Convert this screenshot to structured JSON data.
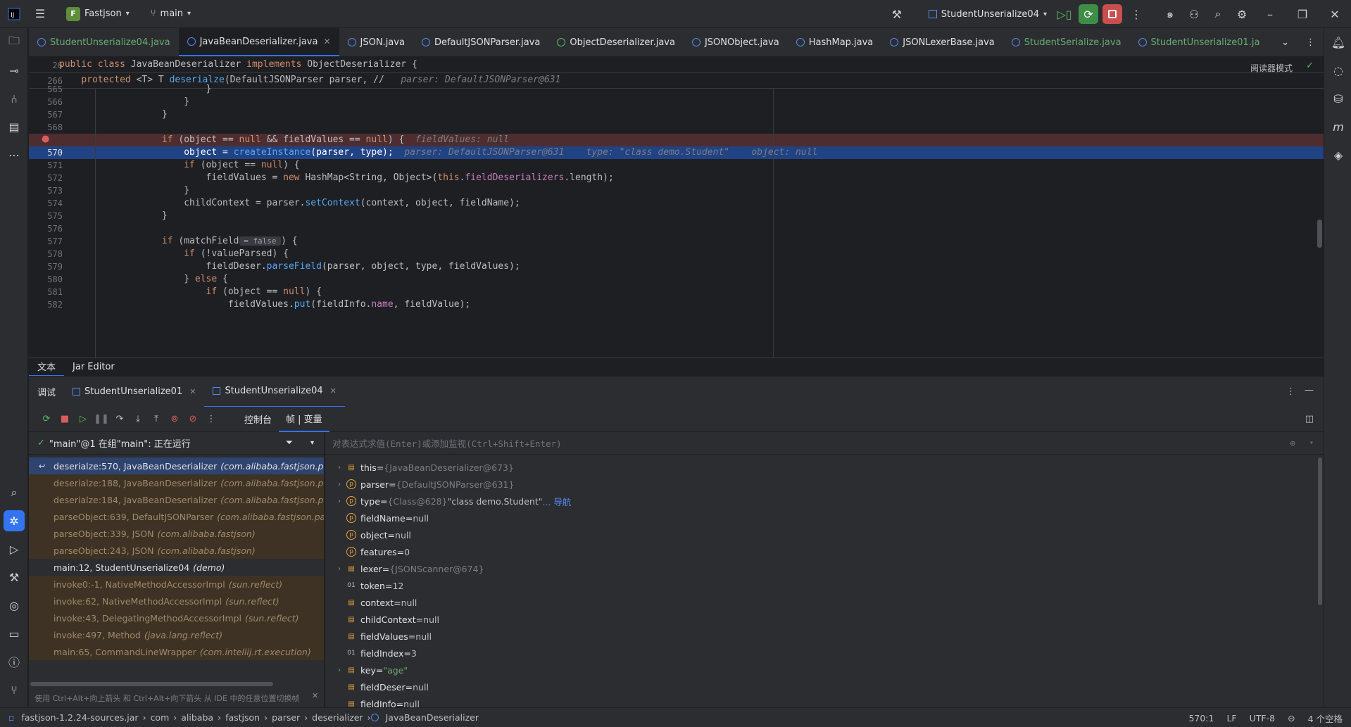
{
  "titlebar": {
    "project_badge": "F",
    "project_name": "Fastjson",
    "branch": "main",
    "run_config": "StudentUnserialize04"
  },
  "tabs": [
    {
      "label": "StudentUnserialize04.java",
      "active": false,
      "closable": false
    },
    {
      "label": "JavaBeanDeserializer.java",
      "active": true,
      "closable": true
    },
    {
      "label": "JSON.java",
      "active": false,
      "closable": false
    },
    {
      "label": "DefaultJSONParser.java",
      "active": false,
      "closable": false
    },
    {
      "label": "ObjectDeserializer.java",
      "active": false,
      "closable": false
    },
    {
      "label": "JSONObject.java",
      "active": false,
      "closable": false
    },
    {
      "label": "HashMap.java",
      "active": false,
      "closable": false
    },
    {
      "label": "JSONLexerBase.java",
      "active": false,
      "closable": false
    },
    {
      "label": "StudentSerialize.java",
      "active": false,
      "closable": false
    },
    {
      "label": "StudentUnserialize01.ja",
      "active": false,
      "closable": false
    }
  ],
  "editor": {
    "reader_mode": "阅读器模式",
    "sticky": [
      {
        "num": "26",
        "code": "public class JavaBeanDeserializer implements ObjectDeserializer {"
      },
      {
        "num": "266",
        "code": "    protected <T> T deserialze(DefaultJSONParser parser, //",
        "hint": "parser: DefaultJSONParser@631"
      }
    ],
    "lines": [
      {
        "num": "565",
        "code": "                    }"
      },
      {
        "num": "566",
        "code": "                }"
      },
      {
        "num": "567",
        "code": "            }"
      },
      {
        "num": "568",
        "code": ""
      },
      {
        "num": "569",
        "code": "            if (object == null && fieldValues == null) {",
        "hint": "fieldValues: null",
        "kind": "breakpoint"
      },
      {
        "num": "570",
        "code": "                object = createInstance(parser, type);",
        "hint": "parser: DefaultJSONParser@631    type: \"class demo.Student\"    object: null",
        "kind": "exec"
      },
      {
        "num": "571",
        "code": "                if (object == null) {"
      },
      {
        "num": "572",
        "code": "                    fieldValues = new HashMap<String, Object>(this.fieldDeserializers.length);"
      },
      {
        "num": "573",
        "code": "                }"
      },
      {
        "num": "574",
        "code": "                childContext = parser.setContext(context, object, fieldName);"
      },
      {
        "num": "575",
        "code": "            }"
      },
      {
        "num": "576",
        "code": ""
      },
      {
        "num": "577",
        "code": "            if (matchField",
        "inline_hint": "= false",
        "code_after": ") {"
      },
      {
        "num": "578",
        "code": "                if (!valueParsed) {"
      },
      {
        "num": "579",
        "code": "                    fieldDeser.parseField(parser, object, type, fieldValues);"
      },
      {
        "num": "580",
        "code": "                } else {"
      },
      {
        "num": "581",
        "code": "                    if (object == null) {"
      },
      {
        "num": "582",
        "code": "                        fieldValues.put(fieldInfo.name, fieldValue);"
      }
    ],
    "bottom_tabs": [
      "文本",
      "Jar Editor"
    ]
  },
  "debug": {
    "title": "调试",
    "sessions": [
      {
        "label": "StudentUnserialize01",
        "active": false
      },
      {
        "label": "StudentUnserialize04",
        "active": true
      }
    ],
    "segments": [
      "控制台",
      "帧 | 变量"
    ],
    "thread": "\"main\"@1 在组\"main\": 正在运行",
    "eval_placeholder": "对表达式求值(Enter)或添加监视(Ctrl+Shift+Enter)",
    "frames": [
      {
        "method": "deserialze:570, JavaBeanDeserializer",
        "pkg": "(com.alibaba.fastjson.parser.",
        "kind": "current"
      },
      {
        "method": "deserialze:188, JavaBeanDeserializer",
        "pkg": "(com.alibaba.fastjson.parser.",
        "kind": "lib"
      },
      {
        "method": "deserialze:184, JavaBeanDeserializer",
        "pkg": "(com.alibaba.fastjson.parser.",
        "kind": "lib"
      },
      {
        "method": "parseObject:639, DefaultJSONParser",
        "pkg": "(com.alibaba.fastjson.parser)",
        "kind": "lib"
      },
      {
        "method": "parseObject:339, JSON",
        "pkg": "(com.alibaba.fastjson)",
        "kind": "lib"
      },
      {
        "method": "parseObject:243, JSON",
        "pkg": "(com.alibaba.fastjson)",
        "kind": "lib"
      },
      {
        "method": "main:12, StudentUnserialize04",
        "pkg": "(demo)",
        "kind": "user"
      },
      {
        "method": "invoke0:-1, NativeMethodAccessorImpl",
        "pkg": "(sun.reflect)",
        "kind": "lib"
      },
      {
        "method": "invoke:62, NativeMethodAccessorImpl",
        "pkg": "(sun.reflect)",
        "kind": "lib"
      },
      {
        "method": "invoke:43, DelegatingMethodAccessorImpl",
        "pkg": "(sun.reflect)",
        "kind": "lib"
      },
      {
        "method": "invoke:497, Method",
        "pkg": "(java.lang.reflect)",
        "kind": "lib"
      },
      {
        "method": "main:65, CommandLineWrapper",
        "pkg": "(com.intellij.rt.execution)",
        "kind": "lib"
      }
    ],
    "frames_hint": "使用 Ctrl+Alt+向上箭头 和 Ctrl+Alt+向下箭头 从 IDE 中的任意位置切换帧",
    "variables": [
      {
        "name": "this",
        "value": "{JavaBeanDeserializer@673}",
        "icon": "f",
        "expandable": true,
        "style": "gray"
      },
      {
        "name": "parser",
        "value": "{DefaultJSONParser@631}",
        "icon": "p",
        "expandable": true,
        "style": "gray"
      },
      {
        "name": "type",
        "value": "{Class@628} \"class demo.Student\"",
        "link": "... 导航",
        "icon": "p",
        "expandable": true,
        "style": "mixed"
      },
      {
        "name": "fieldName",
        "value": "null",
        "icon": "p",
        "expandable": false,
        "style": "val"
      },
      {
        "name": "object",
        "value": "null",
        "icon": "p",
        "expandable": false,
        "style": "val"
      },
      {
        "name": "features",
        "value": "0",
        "icon": "p",
        "expandable": false,
        "style": "val"
      },
      {
        "name": "lexer",
        "value": "{JSONScanner@674}",
        "icon": "f",
        "expandable": true,
        "style": "gray"
      },
      {
        "name": "token",
        "value": "12",
        "icon": "n",
        "expandable": false,
        "style": "val"
      },
      {
        "name": "context",
        "value": "null",
        "icon": "f",
        "expandable": false,
        "style": "val"
      },
      {
        "name": "childContext",
        "value": "null",
        "icon": "f",
        "expandable": false,
        "style": "val"
      },
      {
        "name": "fieldValues",
        "value": "null",
        "icon": "f",
        "expandable": false,
        "style": "val"
      },
      {
        "name": "fieldIndex",
        "value": "3",
        "icon": "n",
        "expandable": false,
        "style": "val"
      },
      {
        "name": "key",
        "value": "\"age\"",
        "icon": "f",
        "expandable": true,
        "style": "str"
      },
      {
        "name": "fieldDeser",
        "value": "null",
        "icon": "f",
        "expandable": false,
        "style": "val"
      },
      {
        "name": "fieldInfo",
        "value": "null",
        "icon": "f",
        "expandable": false,
        "style": "val"
      }
    ]
  },
  "statusbar": {
    "breadcrumbs": [
      "fastjson-1.2.24-sources.jar",
      "com",
      "alibaba",
      "fastjson",
      "parser",
      "deserializer",
      "JavaBeanDeserializer"
    ],
    "position": "570:1",
    "line_sep": "LF",
    "encoding": "UTF-8",
    "indent": "4 个空格"
  }
}
